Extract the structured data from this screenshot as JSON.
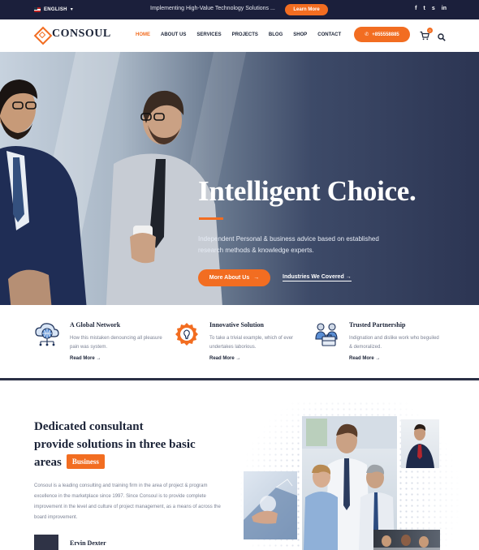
{
  "topbar": {
    "language": "ENGLISH",
    "announcement": "Implementing High-Value Technology Solutions ...",
    "learn_more": "Learn More",
    "socials": [
      "f",
      "t",
      "s",
      "in"
    ]
  },
  "header": {
    "logo": "CONSOUL",
    "nav": [
      "HOME",
      "ABOUT US",
      "SERVICES",
      "PROJECTS",
      "BLOG",
      "SHOP",
      "CONTACT"
    ],
    "active_nav": "HOME",
    "phone": "+855558885",
    "cart_count": "0"
  },
  "hero": {
    "title": "Intelligent Choice.",
    "subtitle": "Independent Personal & business advice based on established research methods & knowledge experts.",
    "primary_button": "More About Us",
    "secondary_link": "Industries We Covered"
  },
  "features": [
    {
      "icon": "global-network-icon",
      "title": "A Global Network",
      "text": "How this mistaken denouncing all pleasure pain was system.",
      "link": "Read More"
    },
    {
      "icon": "innovation-gear-icon",
      "title": "Innovative Solution",
      "text": "To take a trivial example, which of ever undertakes laborious.",
      "link": "Read More"
    },
    {
      "icon": "partnership-icon",
      "title": "Trusted Partnership",
      "text": "Indignation and dislike work who beguiled & demoralized.",
      "link": "Read More"
    }
  ],
  "about": {
    "title_line1": "Dedicated consultant",
    "title_line2": "provide solutions in three basic",
    "title_line3": "areas",
    "tag": "Business",
    "text": "Consoul is a leading consulting and training firm in the area of project & program excellence in the marketplace since 1997. Since Consoul is to provide complete improvement in the level and culture of project management, as a means of across the board improvement.",
    "author": "Ervin Dexter"
  },
  "colors": {
    "accent": "#f26d21",
    "navy": "#1b1f3b",
    "text": "#1b2337",
    "muted": "#7b8294"
  }
}
